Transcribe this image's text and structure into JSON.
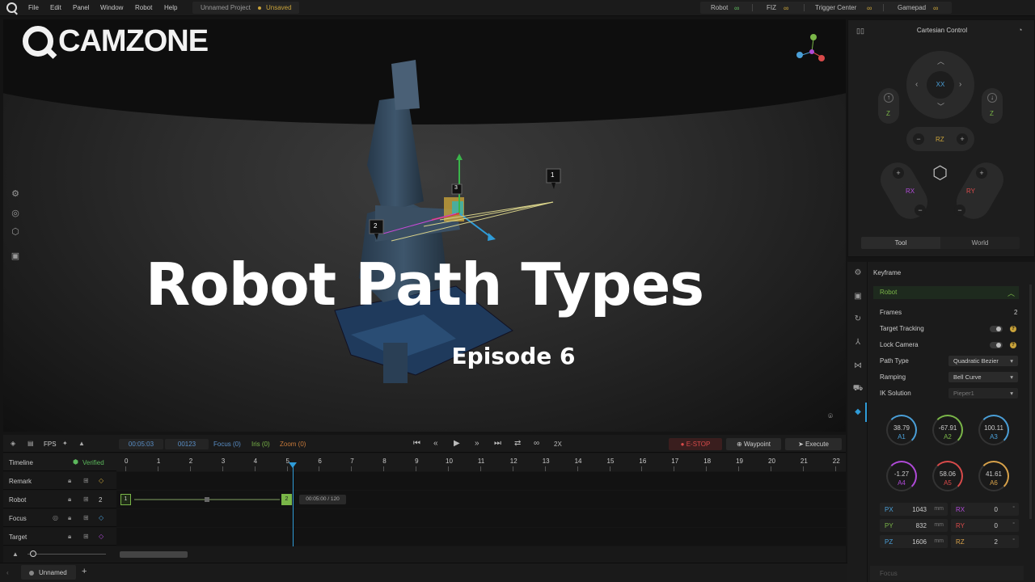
{
  "menubar": {
    "items": [
      "File",
      "Edit",
      "Panel",
      "Window",
      "Robot",
      "Help"
    ],
    "project_name": "Unnamed Project",
    "project_status": "Unsaved",
    "devices": [
      "Robot",
      "FIZ",
      "Trigger Center",
      "Gamepad"
    ]
  },
  "viewport": {
    "brand": "CAMZONE",
    "title": "Robot Path Types",
    "subtitle": "Episode 6",
    "waypoints": [
      "1",
      "2",
      "3"
    ]
  },
  "timeline": {
    "timecode": "00:05:03",
    "frame": "00123",
    "focus": "Focus (0)",
    "iris": "Iris (0)",
    "zoom": "Zoom (0)",
    "speed": "2X",
    "estop": "E-STOP",
    "waypoint": "Waypoint",
    "execute": "Execute",
    "fps_label": "FPS",
    "header_label": "Timeline",
    "verified": "Verified",
    "ruler": [
      "0",
      "1",
      "2",
      "3",
      "4",
      "5",
      "6",
      "7",
      "8",
      "9",
      "10",
      "11",
      "12",
      "13",
      "14",
      "15",
      "16",
      "17",
      "18",
      "19",
      "20",
      "21",
      "22"
    ],
    "playhead_position": 5.1,
    "tracks": [
      {
        "label": "Remark"
      },
      {
        "label": "Robot",
        "count": "2"
      },
      {
        "label": "Focus"
      },
      {
        "label": "Target"
      }
    ],
    "keyframes": [
      "1",
      "2"
    ],
    "keyframe_tooltip": "00:05:00 / 120",
    "tab": "Unnamed"
  },
  "cartesian": {
    "title": "Cartesian Control",
    "center": "XX",
    "z": "Z",
    "rz": "RZ",
    "rx": "RX",
    "ry": "RY",
    "tabs": [
      "Tool",
      "World"
    ]
  },
  "keyframe_panel": {
    "title": "Keyframe",
    "section": "Robot",
    "frames_label": "Frames",
    "frames_value": "2",
    "target_tracking": "Target Tracking",
    "lock_camera": "Lock Camera",
    "path_type_label": "Path Type",
    "path_type_value": "Quadratic Bezier",
    "ramping_label": "Ramping",
    "ramping_value": "Bell Curve",
    "ik_label": "IK Solution",
    "ik_value": "Pieper1",
    "joints": [
      {
        "name": "A1",
        "value": "38.79",
        "color": "#4a9fd8"
      },
      {
        "name": "A2",
        "value": "-67.91",
        "color": "#7ab648"
      },
      {
        "name": "A3",
        "value": "100.11",
        "color": "#4a9fd8"
      },
      {
        "name": "A4",
        "value": "-1.27",
        "color": "#b04ad8"
      },
      {
        "name": "A5",
        "value": "58.06",
        "color": "#d84a4a"
      },
      {
        "name": "A6",
        "value": "41.61",
        "color": "#d8a24a"
      }
    ],
    "pose": [
      {
        "k": "PX",
        "v": "1043",
        "u": "mm",
        "color": "#4a9fd8"
      },
      {
        "k": "RX",
        "v": "0",
        "u": "°",
        "color": "#b04ad8"
      },
      {
        "k": "PY",
        "v": "832",
        "u": "mm",
        "color": "#7ab648"
      },
      {
        "k": "RY",
        "v": "0",
        "u": "°",
        "color": "#d84a4a"
      },
      {
        "k": "PZ",
        "v": "1606",
        "u": "mm",
        "color": "#4a9fd8"
      },
      {
        "k": "RZ",
        "v": "2",
        "u": "°",
        "color": "#d8a24a"
      }
    ],
    "bottom": "Focus"
  }
}
